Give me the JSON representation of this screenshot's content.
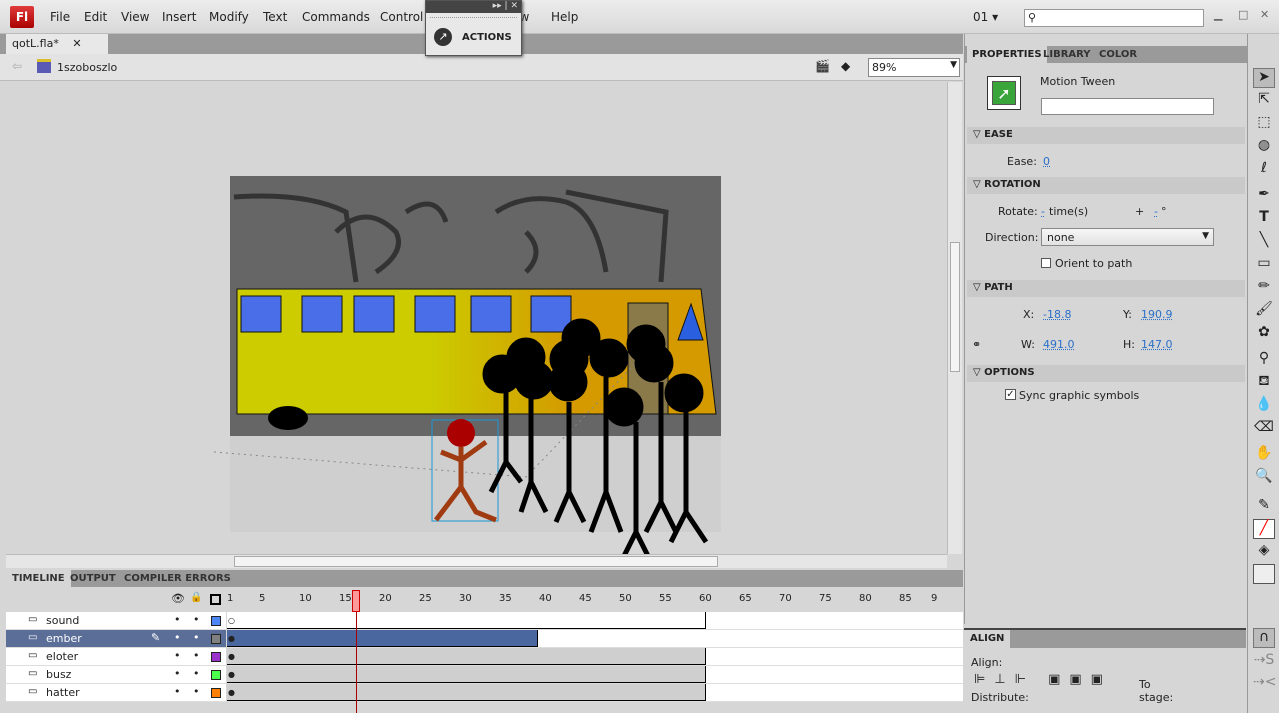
{
  "app": {
    "logo": "Fl",
    "menu": [
      "File",
      "Edit",
      "View",
      "Insert",
      "Modify",
      "Text",
      "Commands",
      "Control",
      "Window",
      "Help"
    ],
    "workspace": "01 ▾",
    "search_value": ""
  },
  "actions_panel": {
    "label": "ACTIONS"
  },
  "document": {
    "tab": "qotL.fla*",
    "scene": "1szoboszlo",
    "zoom": "89%"
  },
  "timeline": {
    "tabs": [
      "TIMELINE",
      "OUTPUT",
      "COMPILER ERRORS"
    ],
    "frame_labels": [
      "1",
      "5",
      "10",
      "15",
      "20",
      "25",
      "30",
      "35",
      "40",
      "45",
      "50",
      "55",
      "60",
      "65",
      "70",
      "75",
      "80",
      "85",
      "9"
    ],
    "current_frame": 17,
    "layers": [
      {
        "name": "sound",
        "color": "#4f86f7",
        "selected": false
      },
      {
        "name": "ember",
        "color": "#808080",
        "selected": true
      },
      {
        "name": "eloter",
        "color": "#9933cc",
        "selected": false
      },
      {
        "name": "busz",
        "color": "#4cff4c",
        "selected": false
      },
      {
        "name": "hatter",
        "color": "#ff8000",
        "selected": false
      }
    ]
  },
  "properties": {
    "tabs": [
      "PROPERTIES",
      "LIBRARY",
      "COLOR"
    ],
    "type": "Motion Tween",
    "instance_name": "",
    "ease": {
      "header": "EASE",
      "label": "Ease:",
      "value": "0"
    },
    "rotation": {
      "header": "ROTATION",
      "rotate_label": "Rotate:",
      "times": "-",
      "times_unit": "time(s)",
      "plus": "+",
      "degrees": "-",
      "deg_unit": "°",
      "direction_label": "Direction:",
      "direction": "none",
      "orient": "Orient to path",
      "orient_checked": false
    },
    "path": {
      "header": "PATH",
      "x_label": "X:",
      "x": "-18.8",
      "y_label": "Y:",
      "y": "190.9",
      "w_label": "W:",
      "w": "491.0",
      "h_label": "H:",
      "h": "147.0"
    },
    "options": {
      "header": "OPTIONS",
      "sync": "Sync graphic symbols",
      "sync_checked": true
    }
  },
  "align": {
    "tab": "ALIGN",
    "align_label": "Align:",
    "distribute_label": "Distribute:",
    "to_stage": "To stage:"
  }
}
